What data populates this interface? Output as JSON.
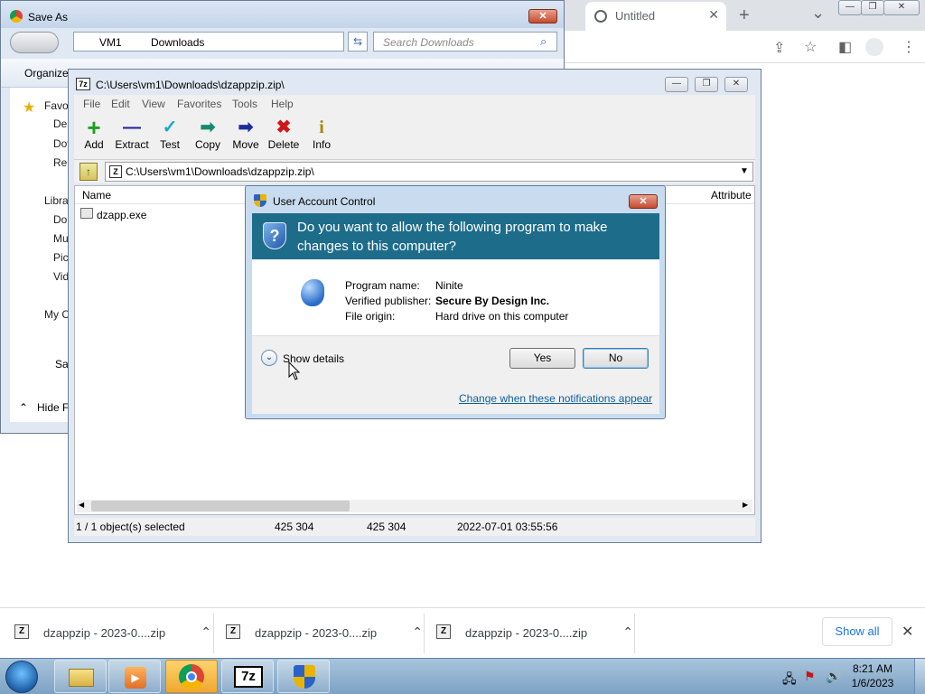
{
  "chrome": {
    "tab_title": "Untitled",
    "tab_close": "✕",
    "new_tab": "+",
    "tab_menu": "⌄"
  },
  "saveas": {
    "title": "Save As",
    "breadcrumb": [
      "VM1",
      "Downloads"
    ],
    "search_placeholder": "Search Downloads",
    "organize_label": "Organize",
    "sidebar": {
      "favorites": "Favo",
      "desktop": "Des",
      "downloads": "Dov",
      "recent": "Rec",
      "libraries": "Libra",
      "documents": "Do",
      "music": "Mu",
      "pictures": "Pic",
      "videos": "Vid",
      "computer": "My C",
      "save": "Sav",
      "hide": "Hide F"
    }
  },
  "sevenzip": {
    "title": "C:\\Users\\vm1\\Downloads\\dzappzip.zip\\",
    "menu": [
      "File",
      "Edit",
      "View",
      "Favorites",
      "Tools",
      "Help"
    ],
    "tools": [
      {
        "label": "Add",
        "icon": "+",
        "color": "#1ea01e"
      },
      {
        "label": "Extract",
        "icon": "—",
        "color": "#1c1ca8"
      },
      {
        "label": "Test",
        "icon": "✓",
        "color": "#18a8c8"
      },
      {
        "label": "Copy",
        "icon": "➡",
        "color": "#148a6e"
      },
      {
        "label": "Move",
        "icon": "➡",
        "color": "#1c2c9c"
      },
      {
        "label": "Delete",
        "icon": "✖",
        "color": "#d01818"
      },
      {
        "label": "Info",
        "icon": "i",
        "color": "#a08a00"
      }
    ],
    "address": "C:\\Users\\vm1\\Downloads\\dzappzip.zip\\",
    "columns": {
      "name": "Name",
      "attributes": "Attribute"
    },
    "files": [
      {
        "name": "dzapp.exe"
      }
    ],
    "status": {
      "selection": "1 / 1 object(s) selected",
      "size": "425 304",
      "packed": "425 304",
      "modified": "2022-07-01 03:55:56"
    }
  },
  "uac": {
    "title": "User Account Control",
    "close": "✕",
    "question": "Do you want to allow the following program to make changes to this computer?",
    "program_name_label": "Program name:",
    "program_name": "Ninite",
    "publisher_label": "Verified publisher:",
    "publisher": "Secure By Design Inc.",
    "origin_label": "File origin:",
    "origin": "Hard drive on this computer",
    "show_details": "Show details",
    "yes": "Yes",
    "no": "No",
    "change_link": "Change when these notifications appear"
  },
  "downloads": {
    "items": [
      {
        "name": "dzappzip - 2023-0....zip"
      },
      {
        "name": "dzappzip - 2023-0....zip"
      },
      {
        "name": "dzappzip - 2023-0....zip"
      }
    ],
    "show_all": "Show all",
    "close": "✕"
  },
  "taskbar": {
    "time": "8:21 AM",
    "date": "1/6/2023"
  }
}
